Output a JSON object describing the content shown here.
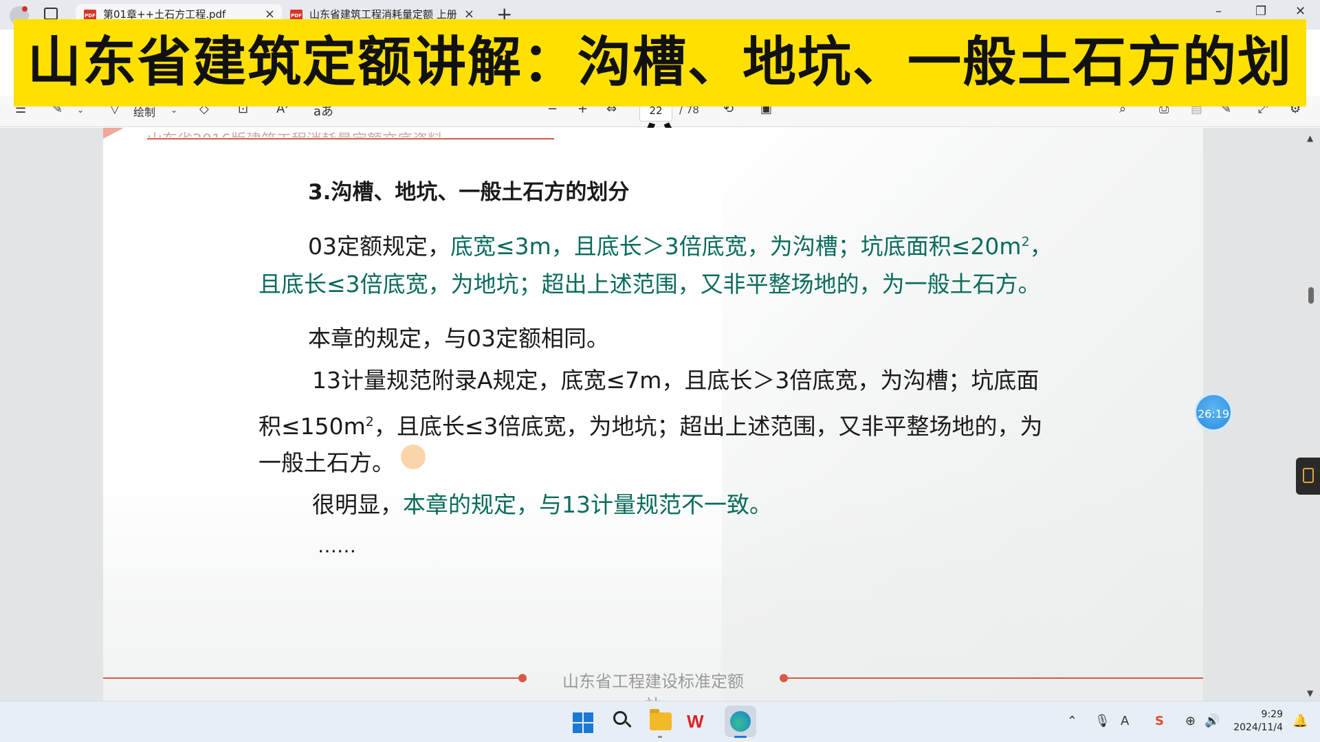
{
  "browser": {
    "tabs": [
      {
        "title": "第01章++土石方工程.pdf",
        "active": true
      },
      {
        "title": "山东省建筑工程消耗量定额 上册",
        "active": false
      }
    ],
    "new_tab_label": "+"
  },
  "banner": {
    "text": "山东省建筑定额讲解：沟槽、地坑、一般土石方的划分",
    "color": "#ffe000"
  },
  "toolbar": {
    "draw_label": "绘制",
    "page_current": "22",
    "page_total": "/ 78"
  },
  "document": {
    "header_partial": "山东省2016版建筑工程消耗量定额交底资料",
    "title": "3.沟槽、地坑、一般土石方的划分",
    "p1_a": "03定额规定，",
    "p1_b": "底宽≤3m，且底长＞3倍底宽，为沟槽；坑底面积≤20m",
    "p1_sup": "2",
    "p1_c": "，",
    "p1_line2": "且底长≤3倍底宽，为地坑；超出上述范围，又非平整场地的，为一般土石方。",
    "p2": "本章的规定，与03定额相同。",
    "p3_line1": "13计量规范附录A规定，底宽≤7m，且底长＞3倍底宽，为沟槽；坑底面",
    "p3_line2_a": "积≤150m",
    "p3_line2_sup": "2",
    "p3_line2_b": "，且底长≤3倍底宽，为地坑；超出上述范围，又非平整场地的，为",
    "p3_line3": "一般土石方。",
    "p4_a": "很明显，",
    "p4_b": "本章的规定，与13计量规范不一致。",
    "ellipsis": "……",
    "footer": "山东省工程建设标准定额站",
    "accent": "#d65a44",
    "highlight": "#0a6b5d"
  },
  "overlay": {
    "timer": "26:19"
  },
  "taskbar": {
    "time": "9:29",
    "date": "2024/11/4"
  }
}
